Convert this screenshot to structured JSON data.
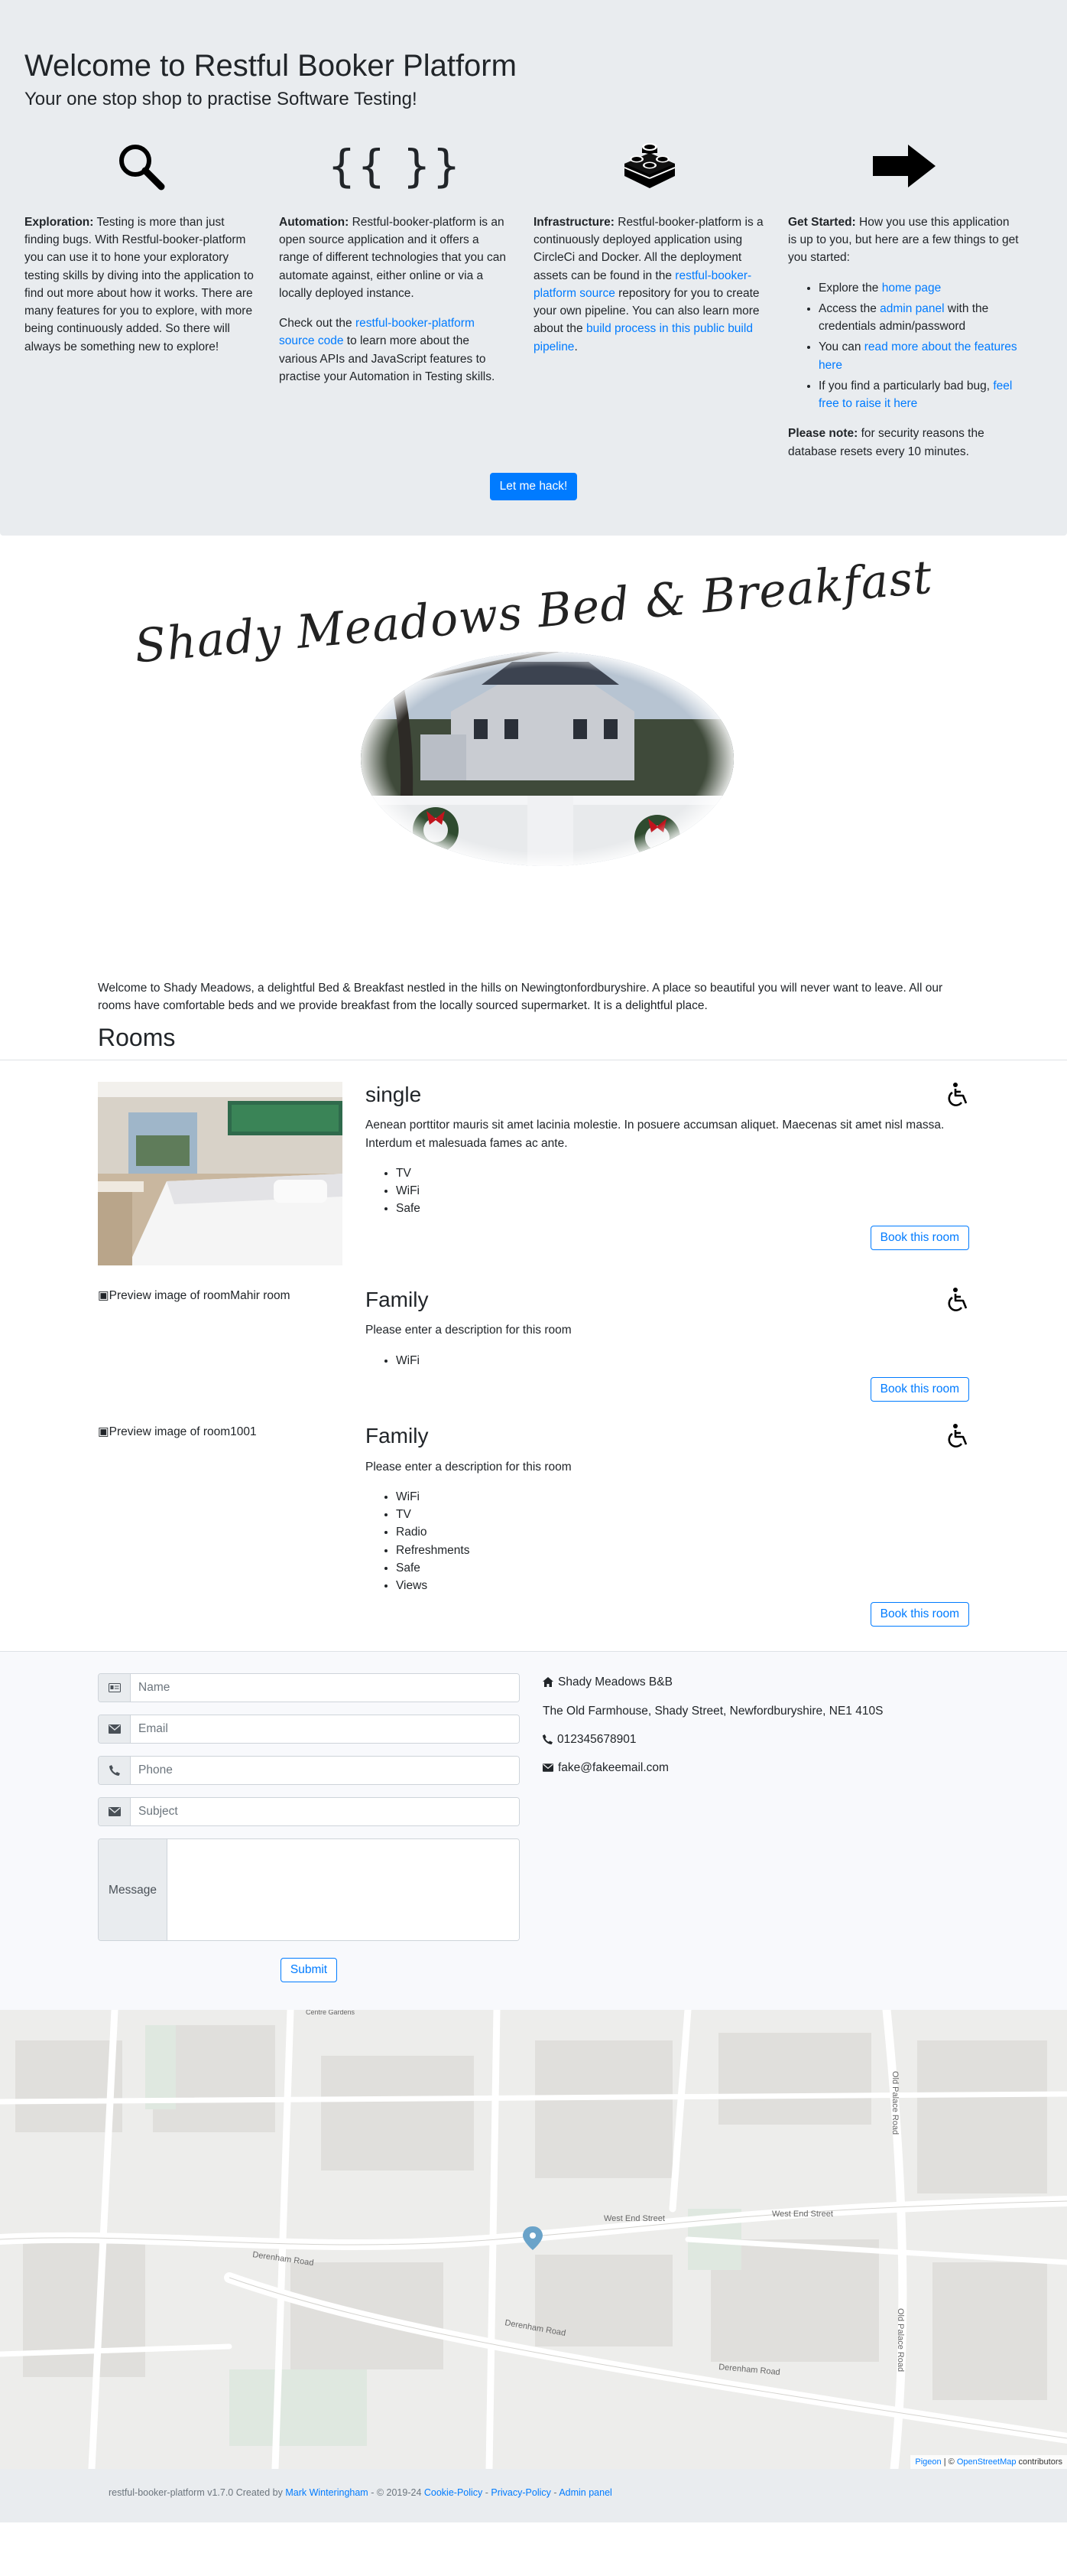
{
  "hero": {
    "title": "Welcome to Restful Booker Platform",
    "subtitle": "Your one stop shop to practise Software Testing!",
    "exploration": {
      "heading": "Exploration:",
      "text": " Testing is more than just finding bugs. With Restful-booker-platform you can use it to hone your exploratory testing skills by diving into the application to find out more about how it works. There are many features for you to explore, with more being continuously added. So there will always be something new to explore!"
    },
    "automation": {
      "heading": "Automation:",
      "text": " Restful-booker-platform is an open source application and it offers a range of different technologies that you can automate against, either online or via a locally deployed instance.",
      "p2_pre": "Check out the ",
      "p2_link": "restful-booker-platform source code",
      "p2_post": " to learn more about the various APIs and JavaScript features to practise your Automation in Testing skills.",
      "braces": "{{ }}"
    },
    "infrastructure": {
      "heading": "Infrastructure:",
      "text": " Restful-booker-platform is a continuously deployed application using CircleCi and Docker. All the deployment assets can be found in the ",
      "link1": "restful-booker-platform source",
      "mid": " repository for you to create your own pipeline. You can also learn more about the ",
      "link2": "build process in this public build pipeline",
      "end": "."
    },
    "getstarted": {
      "heading": "Get Started:",
      "text": " How you use this application is up to you, but here are a few things to get you started:",
      "li1_pre": "Explore the ",
      "li1_link": "home page",
      "li2_pre": "Access the ",
      "li2_link": "admin panel",
      "li2_post": " with the credentials admin/password",
      "li3_pre": "You can ",
      "li3_link": "read more about the features here",
      "li4_pre": "If you find a particularly bad bug, ",
      "li4_link": "feel free to raise it here",
      "note_heading": "Please note:",
      "note_text": " for security reasons the database resets every 10 minutes."
    },
    "hack_button": "Let me hack!"
  },
  "hotel": {
    "logo_text": "Shady Meadows Bed & Breakfast",
    "description": "Welcome to Shady Meadows, a delightful Bed & Breakfast nestled in the hills on Newingtonfordburyshire. A place so beautiful you will never want to leave. All our rooms have comfortable beds and we provide breakfast from the locally sourced supermarket. It is a delightful place."
  },
  "rooms_heading": "Rooms",
  "rooms": [
    {
      "name": "single",
      "description": "Aenean porttitor mauris sit amet lacinia molestie. In posuere accumsan aliquet. Maecenas sit amet nisl massa. Interdum et malesuada fames ac ante.",
      "features": [
        "TV",
        "WiFi",
        "Safe"
      ],
      "book": "Book this room"
    },
    {
      "name": "Family",
      "image_alt": "Preview image of roomMahir room",
      "description": "Please enter a description for this room",
      "features": [
        "WiFi"
      ],
      "book": "Book this room"
    },
    {
      "name": "Family",
      "image_alt": "Preview image of room1001",
      "description": "Please enter a description for this room",
      "features": [
        "WiFi",
        "TV",
        "Radio",
        "Refreshments",
        "Safe",
        "Views"
      ],
      "book": "Book this room"
    }
  ],
  "contact": {
    "name_ph": "Name",
    "email_ph": "Email",
    "phone_ph": "Phone",
    "subject_ph": "Subject",
    "message_label": "Message",
    "submit": "Submit",
    "biz_name": "Shady Meadows B&B",
    "address": "The Old Farmhouse, Shady Street, Newfordburyshire, NE1 410S",
    "phone": "012345678901",
    "email": "fake@fakeemail.com"
  },
  "map": {
    "streets": [
      "Derenham Road",
      "Derenham Road",
      "Derenham Road",
      "West End Street",
      "West End Street",
      "Old Palace Road",
      "Old Palace Road",
      "Centre Gardens"
    ],
    "attrib_link1": "Pigeon",
    "attrib_sep": " | © ",
    "attrib_link2": "OpenStreetMap",
    "attrib_post": " contributors"
  },
  "footer": {
    "pre": "restful-booker-platform v1.7.0 Created by ",
    "author": "Mark Winteringham",
    "mid": " - © 2019-24 ",
    "cookie": "Cookie-Policy",
    "sep1": " - ",
    "privacy": "Privacy-Policy",
    "sep2": " - ",
    "admin": "Admin panel"
  }
}
